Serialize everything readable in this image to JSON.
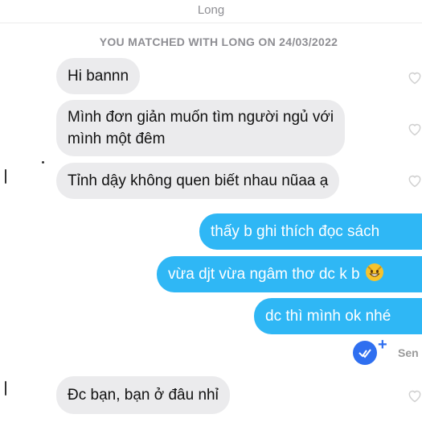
{
  "header": {
    "contact_name": "Long"
  },
  "matched_text": "YOU MATCHED WITH LONG ON 24/03/2022",
  "messages": {
    "m1": "Hi bannn",
    "m2_line1": "Mình đơn giản muốn tìm người ngủ với",
    "m2_line2": "mình một đêm",
    "m3": "Tỉnh dậy không quen biết nhau nũaa ạ",
    "m4": "thấy b ghi thích đọc sách",
    "m5": "vừa djt vừa ngâm thơ dc k b",
    "m6": "dc thì mình ok nhé",
    "m7": "Đc bạn, bạn ở đâu nhỉ"
  },
  "status": {
    "sent_label": "Sen"
  },
  "icons": {
    "like": "heart-outline-icon",
    "read": "checkmark-circle-icon",
    "emoji": "grinning-cat-emoji"
  },
  "colors": {
    "outgoing_bubble": "#2fb7f5",
    "incoming_bubble": "#ebebed",
    "read_receipt": "#2f6ff0"
  }
}
